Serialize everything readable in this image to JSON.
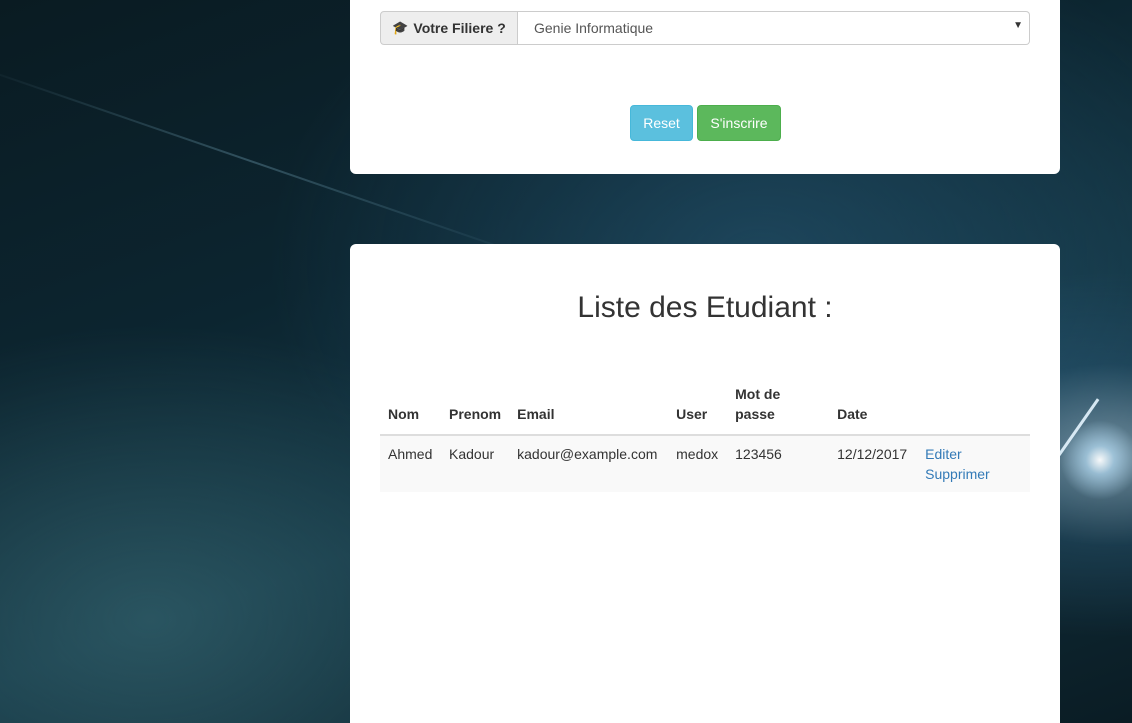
{
  "form": {
    "filiere_label": "Votre Filiere ?",
    "filiere_value": "Genie Informatique",
    "reset_label": "Reset",
    "submit_label": "S'inscrire"
  },
  "list": {
    "title": "Liste des Etudiant :",
    "headers": [
      "Nom",
      "Prenom",
      "Email",
      "User",
      "Mot de passe",
      "Date",
      ""
    ],
    "rows": [
      {
        "nom": "Ahmed",
        "prenom": "Kadour",
        "email": "kadour@example.com",
        "user": "medox",
        "password": "123456",
        "date": "12/12/2017",
        "edit_label": "Editer",
        "delete_label": "Supprimer"
      }
    ]
  },
  "colors": {
    "reset_button": "#5bc0de",
    "submit_button": "#5cb85c",
    "link": "#337ab7"
  },
  "icons": {
    "filiere": "graduation-cap-icon",
    "select_caret": "caret-down-icon"
  }
}
